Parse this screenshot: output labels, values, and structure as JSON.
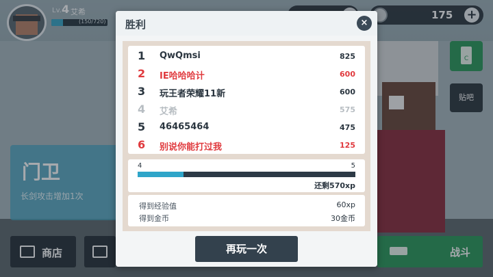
{
  "hud": {
    "level_prefix": "Lv.",
    "level": "4",
    "player_name": "艾希",
    "xp_text": "(150/720)",
    "xp_progress": 0.21,
    "coins": "175"
  },
  "side": {
    "mode_title": "门卫",
    "mode_desc": "长剑攻击增加1次",
    "tieba_label": "贴吧",
    "card_icon_label": "C"
  },
  "bottom": {
    "shop_label": "商店",
    "fight_label": "战斗"
  },
  "modal": {
    "title": "胜利",
    "close_icon": "×",
    "ranking": [
      {
        "rank": "1",
        "name": "QwQmsi",
        "score": "825",
        "color": "#2b3640"
      },
      {
        "rank": "2",
        "name": "IE哈哈哈计",
        "score": "600",
        "color": "#e03a3e"
      },
      {
        "rank": "3",
        "name": "玩王者荣耀11新",
        "score": "600",
        "color": "#2b3640"
      },
      {
        "rank": "4",
        "name": "艾希",
        "score": "575",
        "color": "#b7bdc2"
      },
      {
        "rank": "5",
        "name": "46465464",
        "score": "475",
        "color": "#2b3640"
      },
      {
        "rank": "6",
        "name": "别说你能打过我",
        "score": "125",
        "color": "#e03a3e"
      }
    ],
    "level_from": "4",
    "level_to": "5",
    "level_progress": 0.21,
    "remaining": "还剩570xp",
    "rewards": [
      {
        "label": "得到经验值",
        "value": "60xp"
      },
      {
        "label": "得到金币",
        "value": "30金币"
      }
    ],
    "play_again": "再玩一次"
  },
  "colors": {
    "accent": "#2fa5c9",
    "red": "#e03a3e",
    "green": "#2e9a5c",
    "dark": "#33414d"
  }
}
